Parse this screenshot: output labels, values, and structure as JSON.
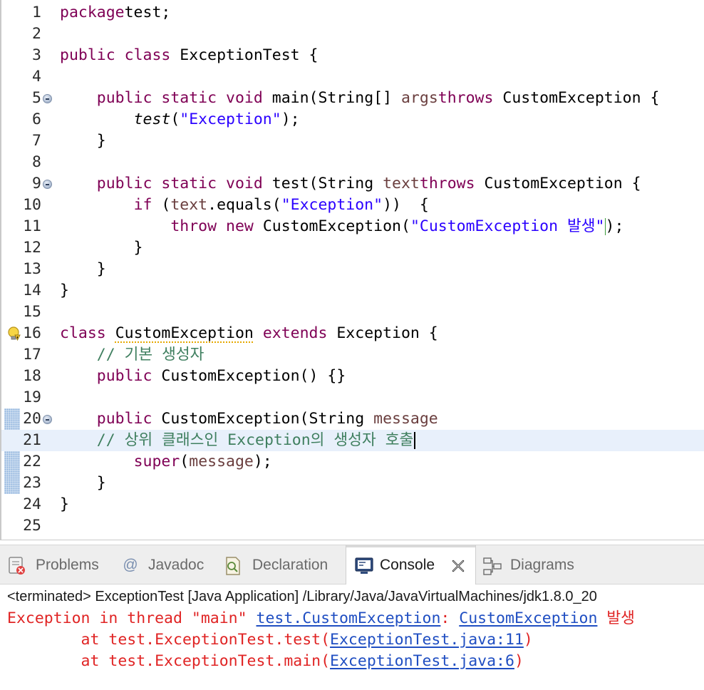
{
  "editor": {
    "lines": [
      {
        "n": "1",
        "tokens": [
          [
            "kw",
            "package"
          ],
          [
            "",
            "test;"
          ]
        ]
      },
      {
        "n": "2",
        "tokens": []
      },
      {
        "n": "3",
        "tokens": [
          [
            "kw",
            "public"
          ],
          [
            "",
            " "
          ],
          [
            "kw",
            "class"
          ],
          [
            "",
            " ExceptionTest {"
          ]
        ]
      },
      {
        "n": "4",
        "tokens": []
      },
      {
        "n": "5",
        "fold": true,
        "tokens": [
          [
            "",
            "    "
          ],
          [
            "kw",
            "public"
          ],
          [
            "",
            " "
          ],
          [
            "kw",
            "static"
          ],
          [
            "",
            " "
          ],
          [
            "kw",
            "void"
          ],
          [
            "",
            " main(String[] "
          ],
          [
            "param",
            "args"
          ],
          [
            ") "
          ],
          [
            "kw",
            "throws"
          ],
          [
            "",
            " CustomException {"
          ]
        ]
      },
      {
        "n": "6",
        "tokens": [
          [
            "",
            "        "
          ],
          [
            "ital",
            "test"
          ],
          [
            "",
            "("
          ],
          [
            "str",
            "\"Exception\""
          ],
          [
            "",
            ");"
          ]
        ]
      },
      {
        "n": "7",
        "tokens": [
          [
            "",
            "    }"
          ]
        ]
      },
      {
        "n": "8",
        "tokens": []
      },
      {
        "n": "9",
        "fold": true,
        "tokens": [
          [
            "",
            "    "
          ],
          [
            "kw",
            "public"
          ],
          [
            "",
            " "
          ],
          [
            "kw",
            "static"
          ],
          [
            "",
            " "
          ],
          [
            "kw",
            "void"
          ],
          [
            "",
            " test(String "
          ],
          [
            "param",
            "text"
          ],
          [
            ") "
          ],
          [
            "kw",
            "throws"
          ],
          [
            "",
            " CustomException {"
          ]
        ]
      },
      {
        "n": "10",
        "tokens": [
          [
            "",
            "        "
          ],
          [
            "kw",
            "if"
          ],
          [
            "",
            " ("
          ],
          [
            "param",
            "text"
          ],
          [
            "",
            ".equals("
          ],
          [
            "str",
            "\"Exception\""
          ],
          [
            "",
            "))  {"
          ]
        ]
      },
      {
        "n": "11",
        "tokens": [
          [
            "",
            "            "
          ],
          [
            "kw",
            "throw"
          ],
          [
            "",
            " "
          ],
          [
            "kw",
            "new"
          ],
          [
            "",
            " CustomException("
          ],
          [
            "str",
            "\"CustomException 발생\""
          ],
          [
            "bracket",
            ""
          ],
          [
            "",
            ");"
          ]
        ]
      },
      {
        "n": "12",
        "tokens": [
          [
            "",
            "        }"
          ]
        ]
      },
      {
        "n": "13",
        "tokens": [
          [
            "",
            "    }"
          ]
        ]
      },
      {
        "n": "14",
        "tokens": [
          [
            "",
            "}"
          ]
        ]
      },
      {
        "n": "15",
        "tokens": []
      },
      {
        "n": "16",
        "bulb": true,
        "tokens": [
          [
            "kw",
            "class"
          ],
          [
            "",
            " "
          ],
          [
            "warn",
            "CustomException"
          ],
          [
            "",
            " "
          ],
          [
            "kw",
            "extends"
          ],
          [
            "",
            " Exception {"
          ]
        ]
      },
      {
        "n": "17",
        "tokens": [
          [
            "",
            "    "
          ],
          [
            "cm",
            "// 기본 생성자"
          ]
        ]
      },
      {
        "n": "18",
        "tokens": [
          [
            "",
            "    "
          ],
          [
            "kw",
            "public"
          ],
          [
            "",
            " CustomException() {}"
          ]
        ]
      },
      {
        "n": "19",
        "tokens": []
      },
      {
        "n": "20",
        "fold": true,
        "changed": true,
        "tokens": [
          [
            "",
            "    "
          ],
          [
            "kw",
            "public"
          ],
          [
            "",
            " CustomException(String "
          ],
          [
            "param",
            "message"
          ],
          [
            ") {"
          ]
        ]
      },
      {
        "n": "21",
        "current": true,
        "changed": true,
        "tokens": [
          [
            "",
            "    "
          ],
          [
            "cm",
            "// 상위 클래스인 Exception의 생성자 호출"
          ],
          [
            "caret",
            ""
          ]
        ]
      },
      {
        "n": "22",
        "changed": true,
        "tokens": [
          [
            "",
            "        "
          ],
          [
            "kw",
            "super"
          ],
          [
            "",
            "("
          ],
          [
            "param",
            "message"
          ],
          [
            "",
            ");"
          ]
        ]
      },
      {
        "n": "23",
        "changed": true,
        "tokens": [
          [
            "",
            "    }"
          ]
        ]
      },
      {
        "n": "24",
        "tokens": [
          [
            "",
            "}"
          ]
        ]
      },
      {
        "n": "25",
        "tokens": []
      }
    ]
  },
  "panel": {
    "tabs": [
      {
        "label": "Problems",
        "icon": "problems-icon",
        "active": false
      },
      {
        "label": "Javadoc",
        "icon": "at-icon",
        "active": false
      },
      {
        "label": "Declaration",
        "icon": "declaration-icon",
        "active": false
      },
      {
        "label": "Console",
        "icon": "console-icon",
        "active": true
      },
      {
        "label": "Diagrams",
        "icon": "diagrams-icon",
        "active": false
      }
    ]
  },
  "console": {
    "status": "<terminated> ExceptionTest [Java Application] /Library/Java/JavaVirtualMachines/jdk1.8.0_20",
    "output": [
      [
        [
          "",
          "Exception in thread \"main\" "
        ],
        [
          "link",
          "test.CustomException"
        ],
        [
          "",
          ": "
        ],
        [
          "link",
          "CustomException"
        ],
        [
          "",
          " 발생"
        ]
      ],
      [
        [
          "",
          "        at test.ExceptionTest.test("
        ],
        [
          "link",
          "ExceptionTest.java:11"
        ],
        [
          "",
          ")"
        ]
      ],
      [
        [
          "",
          "        at test.ExceptionTest.main("
        ],
        [
          "link",
          "ExceptionTest.java:6"
        ],
        [
          "",
          ")"
        ]
      ]
    ]
  },
  "colors": {
    "keyword": "#7f0055",
    "string": "#2a00ff",
    "comment": "#3f7f5f",
    "parameter": "#6a3e3e",
    "error_output": "#e02424",
    "link": "#1f4ec2",
    "current_line": "#e8f0fb"
  }
}
